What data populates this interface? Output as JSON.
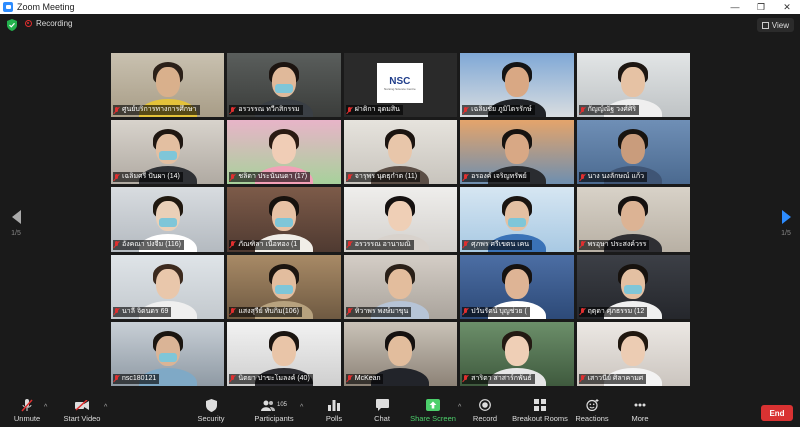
{
  "window": {
    "title": "Zoom Meeting",
    "minimize": "—",
    "restore": "❐",
    "close": "✕"
  },
  "topbar": {
    "recording": "Recording",
    "view": "View"
  },
  "pager": {
    "left": "1/5",
    "right": "1/5"
  },
  "participants": [
    "ศูนย์บริการทางการศึกษา",
    "อรวรรณ ทวีกสิกรรม",
    "ฝาติกา อุดมสิน",
    "เฉลิมชัย ภูมิไตรรักษ์",
    "กัญญ์ณัฐ วงศ์ศิริ",
    "เฉลิมศรี ปันผา (14)",
    "ชลิดา ประนันนดา (17)",
    "จารุพร นุตธุกำ๊ต (11)",
    "อรองค์ เจริญทรัพย์",
    "นาง นงลักษณ์ แก้ว",
    "อังคณา ปงจีม (116)",
    "ภัณฑิลา เนื้อทอง (1",
    "อรวรรณ อานามณิ",
    "ศุภพร ศรีเขตน เคน",
    "พรอุษา ประสงค์วรร",
    "นาลี จิตนดร 69",
    "แสงสุรีย์ ทับกิม(106)",
    "ทิวาพร พงษ์มาขุน",
    "ปวันรัตน์ บุญช่วย (",
    "ฤตุดา ศุภธรรม (12",
    "nsc180121",
    "นิตยา ปาขะโมลงค์ (40)",
    "McKean",
    "สาริตา สาสาร์กพันธ์",
    "เสาวนีย์ ศิลาคามศ"
  ],
  "toolbar": {
    "unmute": "Unmute",
    "start_video": "Start Video",
    "security": "Security",
    "participants": "Participants",
    "participants_count": "105",
    "polls": "Polls",
    "chat": "Chat",
    "share_screen": "Share Screen",
    "record": "Record",
    "breakout_rooms": "Breakout Rooms",
    "reactions": "Reactions",
    "more": "More",
    "end": "End"
  },
  "nsc_logo": {
    "text": "NSC",
    "subtitle": "Nursing Science Centre"
  },
  "colors": {
    "end": "#d93232",
    "share": "#4ccf6b",
    "active_speaker": "#c9e640",
    "accent": "#2d8cff"
  }
}
